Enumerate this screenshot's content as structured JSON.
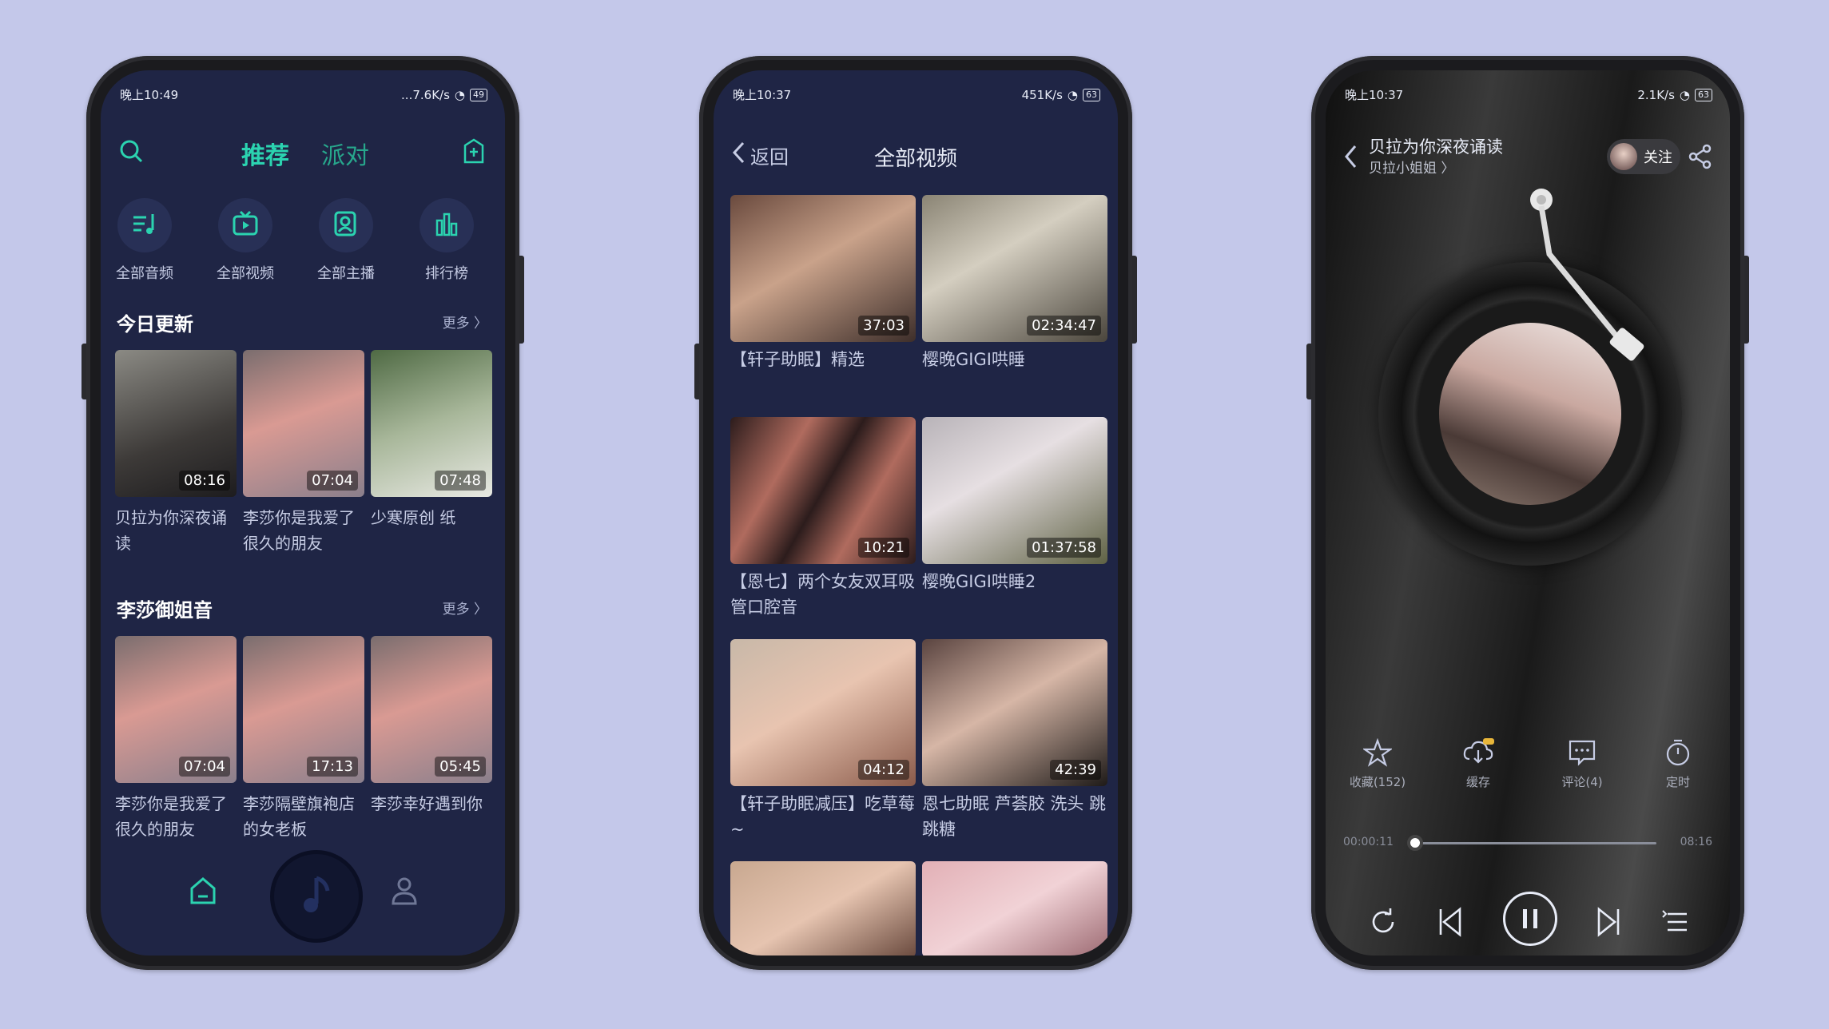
{
  "colors": {
    "background": "#c4c8ea",
    "screen": "#1f2545",
    "accent": "#2bd3b0"
  },
  "phone1": {
    "status": {
      "time": "晚上10:49",
      "speed": "...7.6K/s",
      "battery": "49"
    },
    "tabs": [
      "推荐",
      "派对"
    ],
    "icons": [
      {
        "label": "全部音频",
        "icon": "music-list-icon"
      },
      {
        "label": "全部视频",
        "icon": "tv-icon"
      },
      {
        "label": "全部主播",
        "icon": "anchor-icon"
      },
      {
        "label": "排行榜",
        "icon": "chart-icon"
      }
    ],
    "section1": {
      "title": "今日更新",
      "more": "更多 〉"
    },
    "section1_items": [
      {
        "duration": "08:16",
        "caption": "贝拉为你深夜诵读"
      },
      {
        "duration": "07:04",
        "caption": "李莎你是我爱了很久的朋友"
      },
      {
        "duration": "07:48",
        "caption": "少寒原创 纸"
      }
    ],
    "section2": {
      "title": "李莎御姐音",
      "more": "更多 〉"
    },
    "section2_items": [
      {
        "duration": "07:04",
        "caption": "李莎你是我爱了很久的朋友"
      },
      {
        "duration": "17:13",
        "caption": "李莎隔壁旗袍店的女老板"
      },
      {
        "duration": "05:45",
        "caption": "李莎幸好遇到你"
      }
    ]
  },
  "phone2": {
    "status": {
      "time": "晚上10:37",
      "speed": "451K/s",
      "battery": "63"
    },
    "back": "返回",
    "title": "全部视频",
    "videos": [
      {
        "duration": "37:03",
        "caption": "【轩子助眠】精选"
      },
      {
        "duration": "02:34:47",
        "caption": "樱晚GIGI哄睡"
      },
      {
        "duration": "10:21",
        "caption": "【恩七】两个女友双耳吸管口腔音"
      },
      {
        "duration": "01:37:58",
        "caption": "樱晚GIGI哄睡2"
      },
      {
        "duration": "04:12",
        "caption": "【轩子助眠减压】吃草莓~"
      },
      {
        "duration": "42:39",
        "caption": "恩七助眠 芦荟胶 洗头 跳跳糖"
      }
    ]
  },
  "phone3": {
    "status": {
      "time": "晚上10:37",
      "speed": "2.1K/s",
      "battery": "63"
    },
    "track_title": "贝拉为你深夜诵读",
    "artist": "贝拉小姐姐 〉",
    "follow": "关注",
    "actions": [
      {
        "label": "收藏(152)",
        "icon": "star-icon"
      },
      {
        "label": "缓存",
        "icon": "download-icon"
      },
      {
        "label": "评论(4)",
        "icon": "comment-icon"
      },
      {
        "label": "定时",
        "icon": "timer-icon"
      }
    ],
    "progress": {
      "current": "00:00:11",
      "total": "08:16",
      "fraction": 0.02
    }
  }
}
